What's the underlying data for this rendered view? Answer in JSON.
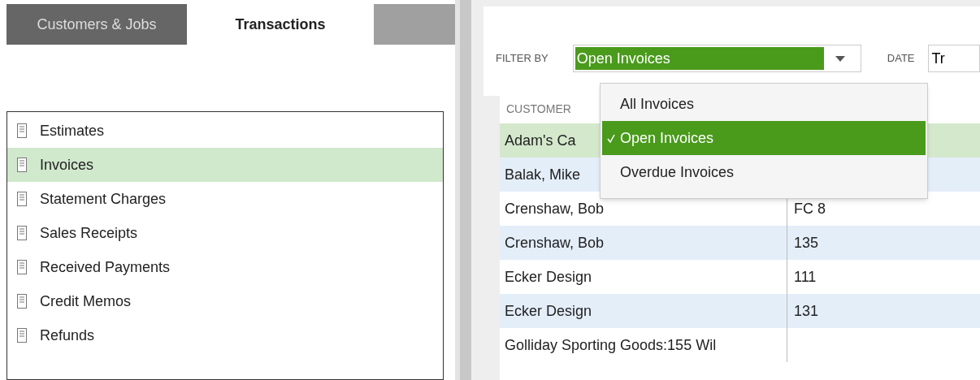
{
  "tabs": [
    {
      "label": "Customers & Jobs",
      "selected": false
    },
    {
      "label": "Transactions",
      "selected": true
    }
  ],
  "transaction_list": [
    {
      "label": "Estimates",
      "selected": false
    },
    {
      "label": "Invoices",
      "selected": true
    },
    {
      "label": "Statement Charges",
      "selected": false
    },
    {
      "label": "Sales Receipts",
      "selected": false
    },
    {
      "label": "Received Payments",
      "selected": false
    },
    {
      "label": "Credit Memos",
      "selected": false
    },
    {
      "label": "Refunds",
      "selected": false
    }
  ],
  "filter": {
    "label": "FILTER BY",
    "value": "Open Invoices",
    "expanded": true,
    "options": [
      {
        "label": "All Invoices",
        "selected": false
      },
      {
        "label": "Open Invoices",
        "selected": true
      },
      {
        "label": "Overdue Invoices",
        "selected": false
      }
    ]
  },
  "date": {
    "label": "DATE",
    "value": "Tr"
  },
  "table": {
    "columns": [
      "CUSTOMER"
    ],
    "rows": [
      {
        "cells": [
          "Adam's Ca",
          ""
        ],
        "selected": true
      },
      {
        "cells": [
          "Balak, Mike",
          ""
        ],
        "selected": false
      },
      {
        "cells": [
          "Crenshaw, Bob",
          "FC 8"
        ],
        "selected": false
      },
      {
        "cells": [
          "Crenshaw, Bob",
          "135"
        ],
        "selected": false
      },
      {
        "cells": [
          "Ecker Design",
          "111"
        ],
        "selected": false
      },
      {
        "cells": [
          "Ecker Design",
          "131"
        ],
        "selected": false
      },
      {
        "cells": [
          "Golliday Sporting Goods:155 Wil",
          ""
        ],
        "selected": false
      }
    ]
  }
}
